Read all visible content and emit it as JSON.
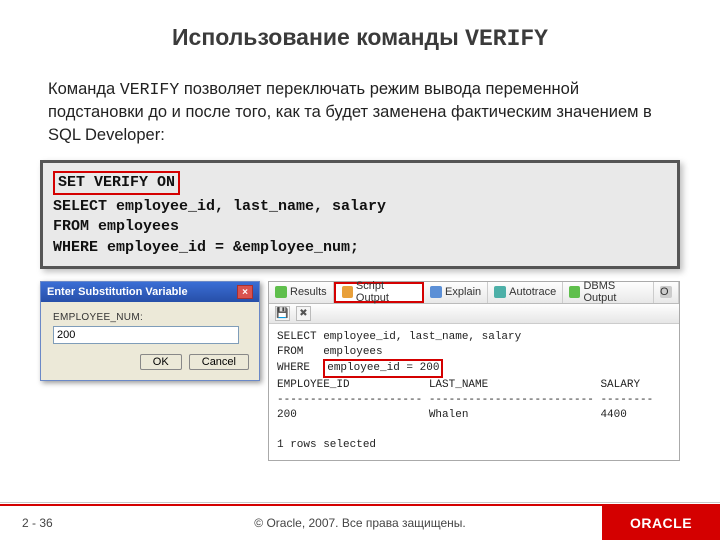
{
  "title": {
    "prefix": "Использование команды ",
    "cmd": "VERIFY"
  },
  "body": {
    "part1": "Команда ",
    "verify": "VERIFY",
    "part2": " позволяет переключать режим вывода переменной подстановки до и после того, как та будет заменена фактическим значением в SQL Developer:"
  },
  "code": {
    "l1": "SET VERIFY ON",
    "l2": "SELECT employee_id, last_name, salary",
    "l3": "FROM   employees",
    "l4": "WHERE  employee_id = &employee_num;"
  },
  "dialog": {
    "title": "Enter Substitution Variable",
    "label": "EMPLOYEE_NUM:",
    "value": "200",
    "ok": "OK",
    "cancel": "Cancel"
  },
  "tabs": {
    "results": "Results",
    "script": "Script Output",
    "explain": "Explain",
    "autotrace": "Autotrace",
    "dbms": "DBMS Output",
    "owa_icon": "O"
  },
  "output": {
    "l1": "SELECT employee_id, last_name, salary",
    "l2": "FROM   employees",
    "l3a": "WHERE  ",
    "l3b": "employee_id = 200",
    "l4": "EMPLOYEE_ID            LAST_NAME                 SALARY",
    "l5": "---------------------- ------------------------- --------",
    "l6": "200                    Whalen                    4400",
    "l7": "",
    "l8": "1 rows selected"
  },
  "footer": {
    "page_prefix": "2 - ",
    "page_num": "36",
    "copyright": "© Oracle, 2007. Все права защищены.",
    "brand": "ORACLE"
  }
}
